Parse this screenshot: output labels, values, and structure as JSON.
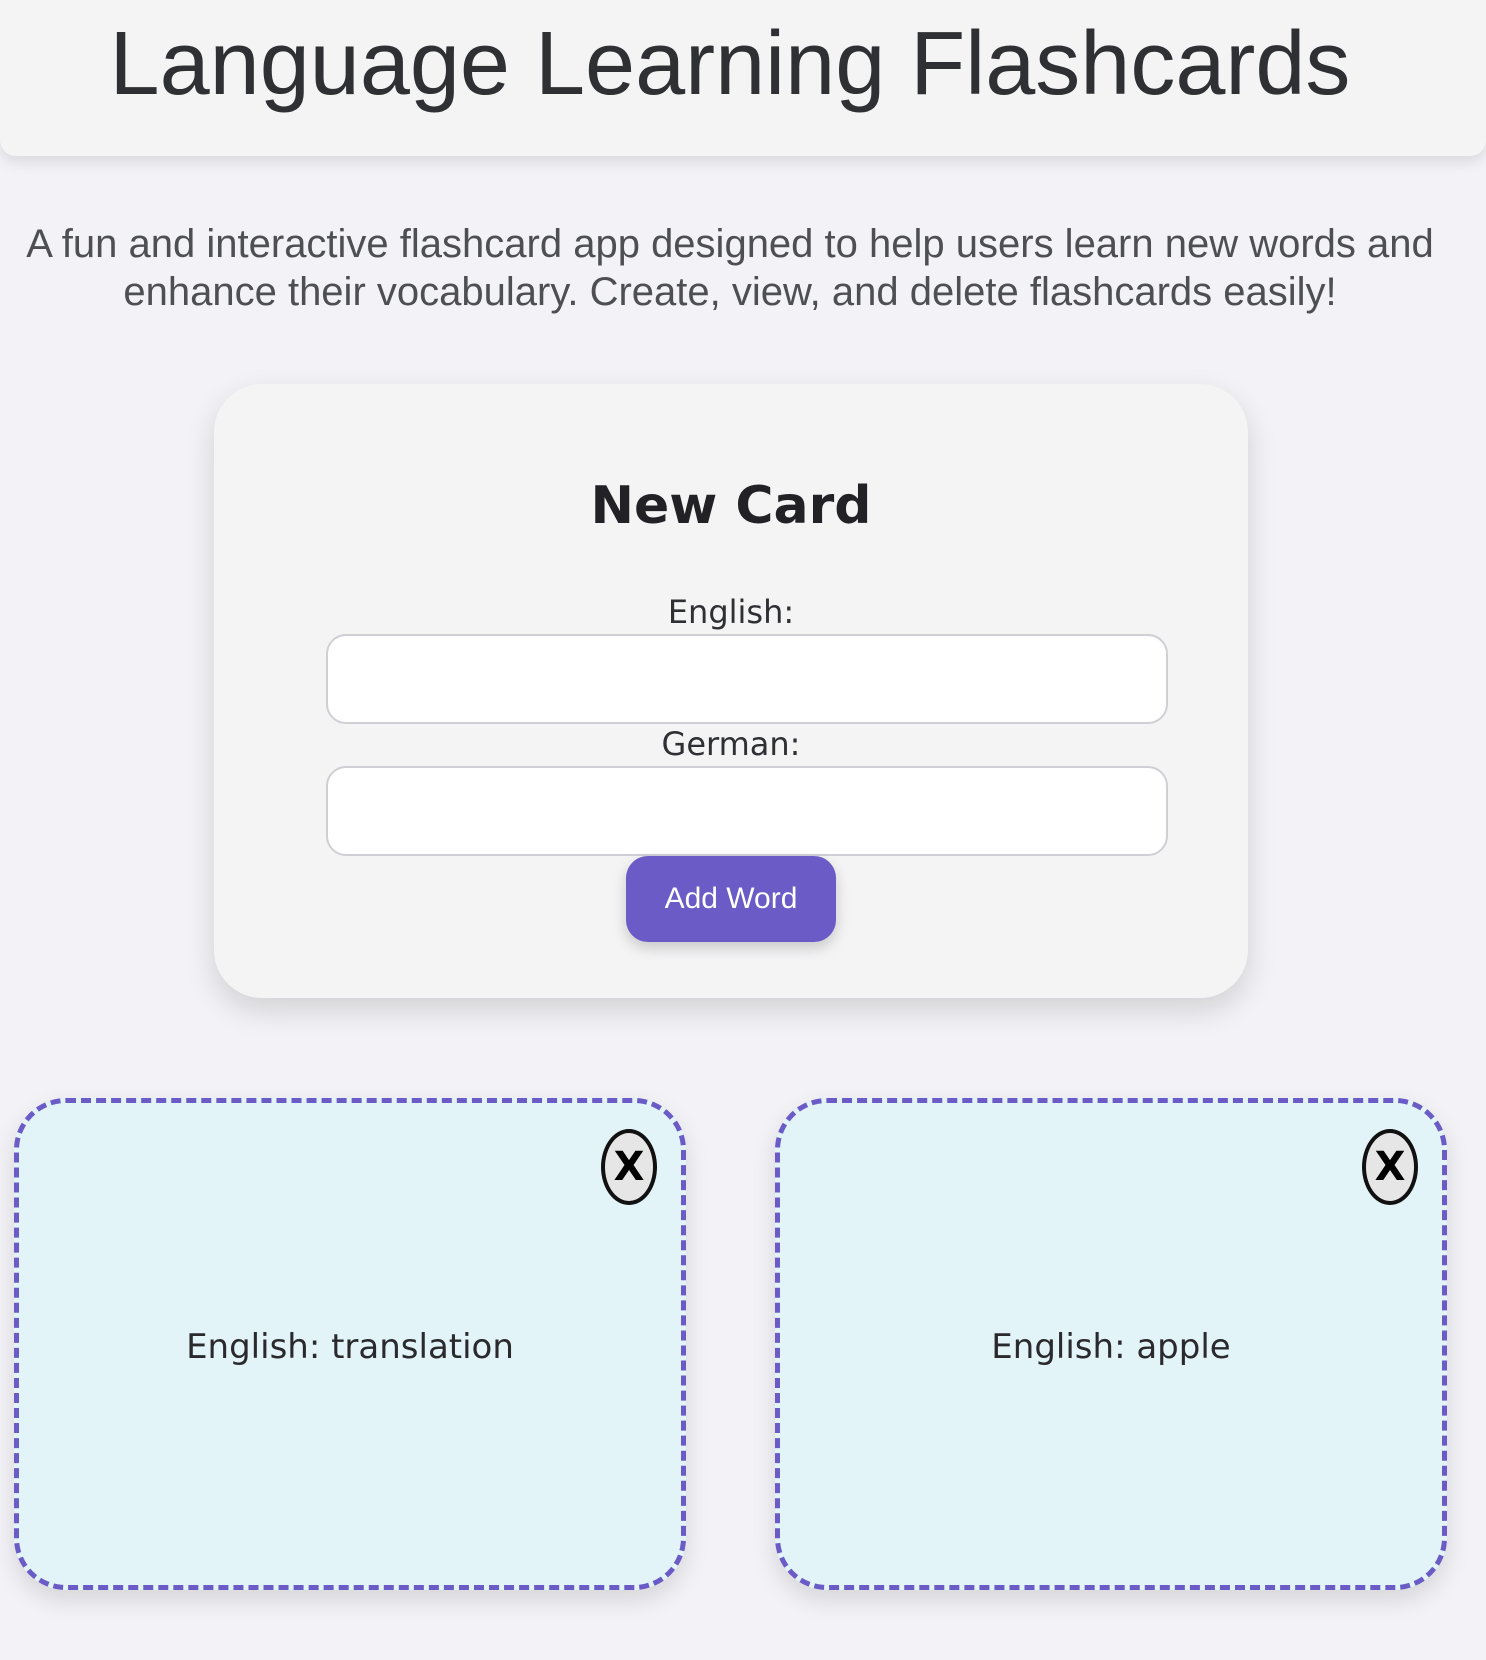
{
  "header": {
    "title": "Language Learning Flashcards"
  },
  "intro": {
    "text": "A fun and interactive flashcard app designed to help users learn new words and enhance their vocabulary. Create, view, and delete flashcards easily!"
  },
  "new_card": {
    "title": "New Card",
    "english_label": "English:",
    "english_value": "",
    "german_label": "German:",
    "german_value": "",
    "add_button_label": "Add Word"
  },
  "cards": [
    {
      "text": "English: translation",
      "delete_label": "X",
      "delete_icon": "close-icon"
    },
    {
      "text": "English: apple",
      "delete_label": "X",
      "delete_icon": "close-icon"
    }
  ],
  "colors": {
    "accent": "#6a5bc7",
    "card_background": "#e3f4f8",
    "page_background": "#f3f3f7",
    "panel_background": "#f4f4f5"
  }
}
